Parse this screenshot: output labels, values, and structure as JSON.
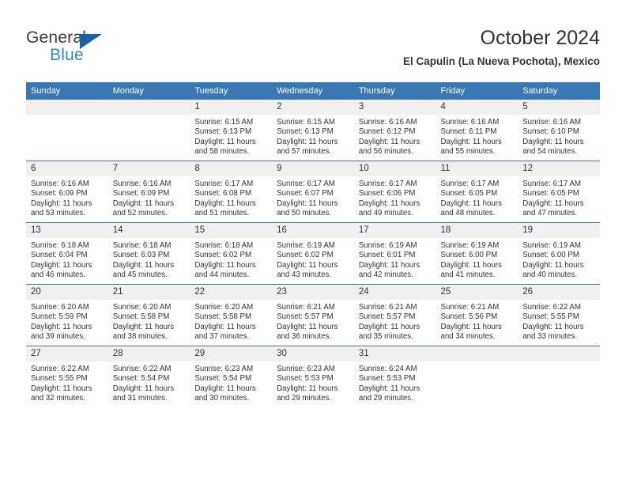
{
  "brand": {
    "name_top": "General",
    "name_bottom": "Blue",
    "triangle_color": "#1464aa",
    "blue_color": "#2a86d4"
  },
  "header": {
    "title": "October 2024",
    "subtitle": "El Capulin (La Nueva Pochota), Mexico"
  },
  "theme": {
    "header_row_bg": "#3878b4",
    "daynum_bg": "#f0f0f0",
    "grid_line": "#3878b4",
    "text": "#333333"
  },
  "weekday_headers": [
    "Sunday",
    "Monday",
    "Tuesday",
    "Wednesday",
    "Thursday",
    "Friday",
    "Saturday"
  ],
  "weeks": [
    [
      {
        "day": "",
        "sunrise": "",
        "sunset": "",
        "daylight_line1": "",
        "daylight_line2": ""
      },
      {
        "day": "",
        "sunrise": "",
        "sunset": "",
        "daylight_line1": "",
        "daylight_line2": ""
      },
      {
        "day": "1",
        "sunrise": "Sunrise: 6:15 AM",
        "sunset": "Sunset: 6:13 PM",
        "daylight_line1": "Daylight: 11 hours",
        "daylight_line2": "and 58 minutes."
      },
      {
        "day": "2",
        "sunrise": "Sunrise: 6:15 AM",
        "sunset": "Sunset: 6:13 PM",
        "daylight_line1": "Daylight: 11 hours",
        "daylight_line2": "and 57 minutes."
      },
      {
        "day": "3",
        "sunrise": "Sunrise: 6:16 AM",
        "sunset": "Sunset: 6:12 PM",
        "daylight_line1": "Daylight: 11 hours",
        "daylight_line2": "and 56 minutes."
      },
      {
        "day": "4",
        "sunrise": "Sunrise: 6:16 AM",
        "sunset": "Sunset: 6:11 PM",
        "daylight_line1": "Daylight: 11 hours",
        "daylight_line2": "and 55 minutes."
      },
      {
        "day": "5",
        "sunrise": "Sunrise: 6:16 AM",
        "sunset": "Sunset: 6:10 PM",
        "daylight_line1": "Daylight: 11 hours",
        "daylight_line2": "and 54 minutes."
      }
    ],
    [
      {
        "day": "6",
        "sunrise": "Sunrise: 6:16 AM",
        "sunset": "Sunset: 6:09 PM",
        "daylight_line1": "Daylight: 11 hours",
        "daylight_line2": "and 53 minutes."
      },
      {
        "day": "7",
        "sunrise": "Sunrise: 6:16 AM",
        "sunset": "Sunset: 6:09 PM",
        "daylight_line1": "Daylight: 11 hours",
        "daylight_line2": "and 52 minutes."
      },
      {
        "day": "8",
        "sunrise": "Sunrise: 6:17 AM",
        "sunset": "Sunset: 6:08 PM",
        "daylight_line1": "Daylight: 11 hours",
        "daylight_line2": "and 51 minutes."
      },
      {
        "day": "9",
        "sunrise": "Sunrise: 6:17 AM",
        "sunset": "Sunset: 6:07 PM",
        "daylight_line1": "Daylight: 11 hours",
        "daylight_line2": "and 50 minutes."
      },
      {
        "day": "10",
        "sunrise": "Sunrise: 6:17 AM",
        "sunset": "Sunset: 6:06 PM",
        "daylight_line1": "Daylight: 11 hours",
        "daylight_line2": "and 49 minutes."
      },
      {
        "day": "11",
        "sunrise": "Sunrise: 6:17 AM",
        "sunset": "Sunset: 6:05 PM",
        "daylight_line1": "Daylight: 11 hours",
        "daylight_line2": "and 48 minutes."
      },
      {
        "day": "12",
        "sunrise": "Sunrise: 6:17 AM",
        "sunset": "Sunset: 6:05 PM",
        "daylight_line1": "Daylight: 11 hours",
        "daylight_line2": "and 47 minutes."
      }
    ],
    [
      {
        "day": "13",
        "sunrise": "Sunrise: 6:18 AM",
        "sunset": "Sunset: 6:04 PM",
        "daylight_line1": "Daylight: 11 hours",
        "daylight_line2": "and 46 minutes."
      },
      {
        "day": "14",
        "sunrise": "Sunrise: 6:18 AM",
        "sunset": "Sunset: 6:03 PM",
        "daylight_line1": "Daylight: 11 hours",
        "daylight_line2": "and 45 minutes."
      },
      {
        "day": "15",
        "sunrise": "Sunrise: 6:18 AM",
        "sunset": "Sunset: 6:02 PM",
        "daylight_line1": "Daylight: 11 hours",
        "daylight_line2": "and 44 minutes."
      },
      {
        "day": "16",
        "sunrise": "Sunrise: 6:19 AM",
        "sunset": "Sunset: 6:02 PM",
        "daylight_line1": "Daylight: 11 hours",
        "daylight_line2": "and 43 minutes."
      },
      {
        "day": "17",
        "sunrise": "Sunrise: 6:19 AM",
        "sunset": "Sunset: 6:01 PM",
        "daylight_line1": "Daylight: 11 hours",
        "daylight_line2": "and 42 minutes."
      },
      {
        "day": "18",
        "sunrise": "Sunrise: 6:19 AM",
        "sunset": "Sunset: 6:00 PM",
        "daylight_line1": "Daylight: 11 hours",
        "daylight_line2": "and 41 minutes."
      },
      {
        "day": "19",
        "sunrise": "Sunrise: 6:19 AM",
        "sunset": "Sunset: 6:00 PM",
        "daylight_line1": "Daylight: 11 hours",
        "daylight_line2": "and 40 minutes."
      }
    ],
    [
      {
        "day": "20",
        "sunrise": "Sunrise: 6:20 AM",
        "sunset": "Sunset: 5:59 PM",
        "daylight_line1": "Daylight: 11 hours",
        "daylight_line2": "and 39 minutes."
      },
      {
        "day": "21",
        "sunrise": "Sunrise: 6:20 AM",
        "sunset": "Sunset: 5:58 PM",
        "daylight_line1": "Daylight: 11 hours",
        "daylight_line2": "and 38 minutes."
      },
      {
        "day": "22",
        "sunrise": "Sunrise: 6:20 AM",
        "sunset": "Sunset: 5:58 PM",
        "daylight_line1": "Daylight: 11 hours",
        "daylight_line2": "and 37 minutes."
      },
      {
        "day": "23",
        "sunrise": "Sunrise: 6:21 AM",
        "sunset": "Sunset: 5:57 PM",
        "daylight_line1": "Daylight: 11 hours",
        "daylight_line2": "and 36 minutes."
      },
      {
        "day": "24",
        "sunrise": "Sunrise: 6:21 AM",
        "sunset": "Sunset: 5:57 PM",
        "daylight_line1": "Daylight: 11 hours",
        "daylight_line2": "and 35 minutes."
      },
      {
        "day": "25",
        "sunrise": "Sunrise: 6:21 AM",
        "sunset": "Sunset: 5:56 PM",
        "daylight_line1": "Daylight: 11 hours",
        "daylight_line2": "and 34 minutes."
      },
      {
        "day": "26",
        "sunrise": "Sunrise: 6:22 AM",
        "sunset": "Sunset: 5:55 PM",
        "daylight_line1": "Daylight: 11 hours",
        "daylight_line2": "and 33 minutes."
      }
    ],
    [
      {
        "day": "27",
        "sunrise": "Sunrise: 6:22 AM",
        "sunset": "Sunset: 5:55 PM",
        "daylight_line1": "Daylight: 11 hours",
        "daylight_line2": "and 32 minutes."
      },
      {
        "day": "28",
        "sunrise": "Sunrise: 6:22 AM",
        "sunset": "Sunset: 5:54 PM",
        "daylight_line1": "Daylight: 11 hours",
        "daylight_line2": "and 31 minutes."
      },
      {
        "day": "29",
        "sunrise": "Sunrise: 6:23 AM",
        "sunset": "Sunset: 5:54 PM",
        "daylight_line1": "Daylight: 11 hours",
        "daylight_line2": "and 30 minutes."
      },
      {
        "day": "30",
        "sunrise": "Sunrise: 6:23 AM",
        "sunset": "Sunset: 5:53 PM",
        "daylight_line1": "Daylight: 11 hours",
        "daylight_line2": "and 29 minutes."
      },
      {
        "day": "31",
        "sunrise": "Sunrise: 6:24 AM",
        "sunset": "Sunset: 5:53 PM",
        "daylight_line1": "Daylight: 11 hours",
        "daylight_line2": "and 29 minutes."
      },
      {
        "day": "",
        "sunrise": "",
        "sunset": "",
        "daylight_line1": "",
        "daylight_line2": ""
      },
      {
        "day": "",
        "sunrise": "",
        "sunset": "",
        "daylight_line1": "",
        "daylight_line2": ""
      }
    ]
  ]
}
